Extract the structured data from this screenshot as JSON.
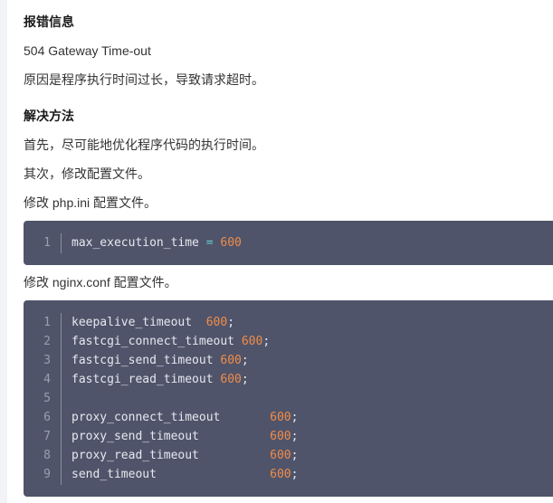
{
  "sections": {
    "error_heading": "报错信息",
    "error_code": "504 Gateway Time-out",
    "error_reason": "原因是程序执行时间过长，导致请求超时。",
    "solution_heading": "解决方法",
    "step1": "首先，尽可能地优化程序代码的执行时间。",
    "step2": "其次，修改配置文件。",
    "php_label": "修改 php.ini 配置文件。",
    "nginx_label": "修改 nginx.conf 配置文件。"
  },
  "php_code": [
    {
      "n": "1",
      "key": "max_execution_time",
      "sep": " = ",
      "val": "600",
      "end": ""
    }
  ],
  "nginx_code": [
    {
      "n": "1",
      "key": "keepalive_timeout  ",
      "val": "600",
      "end": ";"
    },
    {
      "n": "2",
      "key": "fastcgi_connect_timeout ",
      "val": "600",
      "end": ";"
    },
    {
      "n": "3",
      "key": "fastcgi_send_timeout ",
      "val": "600",
      "end": ";"
    },
    {
      "n": "4",
      "key": "fastcgi_read_timeout ",
      "val": "600",
      "end": ";"
    },
    {
      "n": "5",
      "key": "",
      "val": "",
      "end": ""
    },
    {
      "n": "6",
      "key": "proxy_connect_timeout       ",
      "val": "600",
      "end": ";"
    },
    {
      "n": "7",
      "key": "proxy_send_timeout          ",
      "val": "600",
      "end": ";"
    },
    {
      "n": "8",
      "key": "proxy_read_timeout          ",
      "val": "600",
      "end": ";"
    },
    {
      "n": "9",
      "key": "send_timeout                ",
      "val": "600",
      "end": ";"
    }
  ]
}
